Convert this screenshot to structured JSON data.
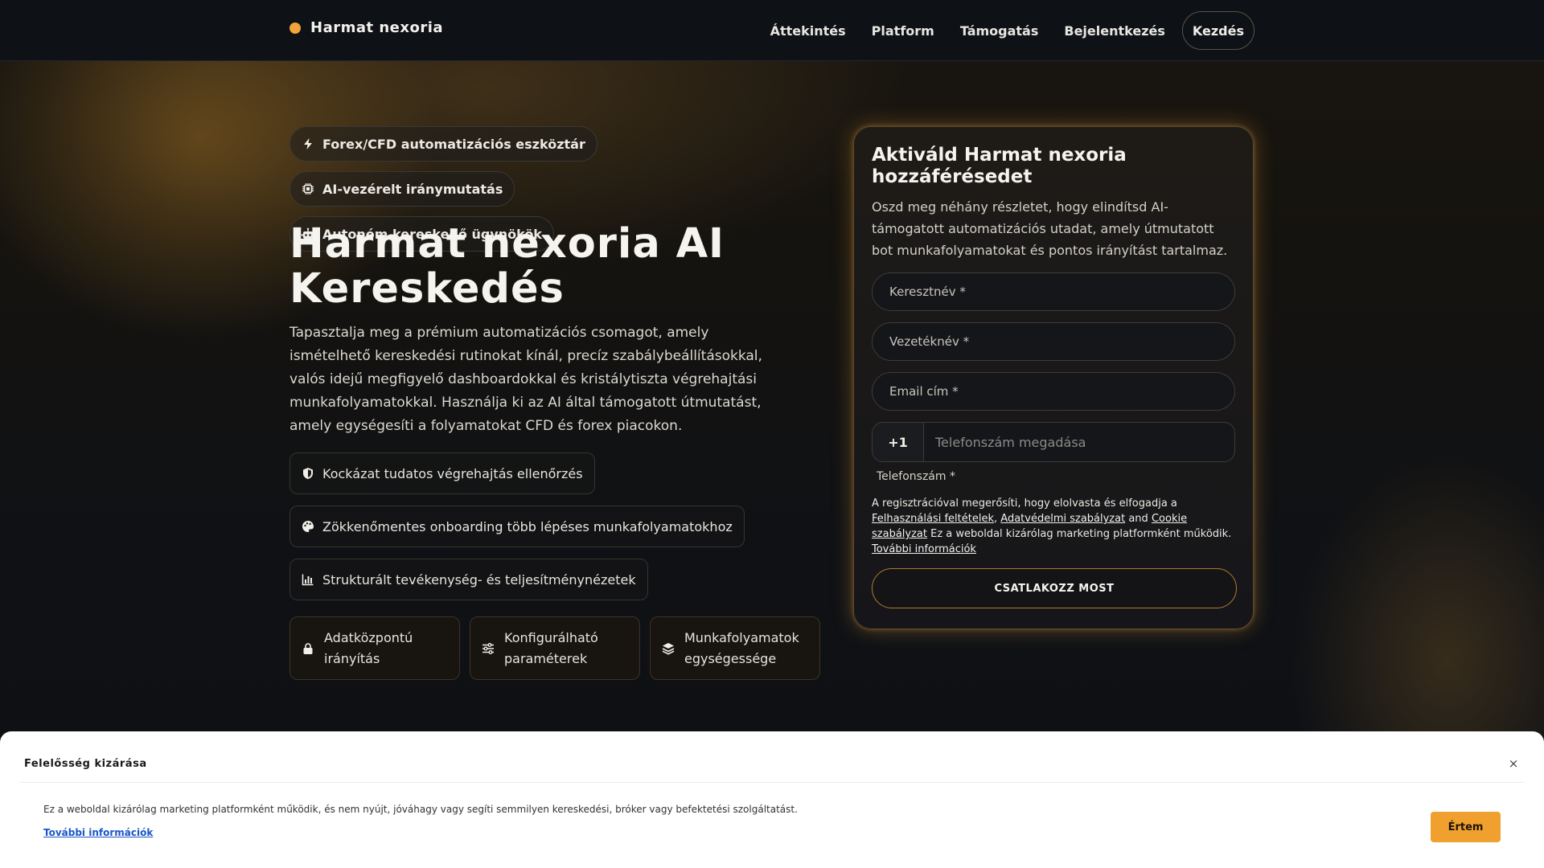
{
  "brand": {
    "name": "Harmat nexoria",
    "accent": "#f0a43a"
  },
  "nav": {
    "links": [
      "Áttekintés",
      "Platform",
      "Támogatás",
      "Bejelentkezés"
    ],
    "cta": "Kezdés"
  },
  "hero": {
    "pills": [
      {
        "icon": "lightning-icon",
        "label": "Forex/CFD automatizációs eszköztár"
      },
      {
        "icon": "chip-icon",
        "label": "AI-vezérelt iránymutatás"
      },
      {
        "icon": "robot-icon",
        "label": "Autonóm kereskedő ügynökök"
      }
    ],
    "title": "Harmat nexoria AI Kereskedés",
    "description": "Tapasztalja meg a prémium automatizációs csomagot, amely ismételhető kereskedési rutinokat kínál, precíz szabálybeállításokkal, valós idejű megfigyelő dashboardokkal és kristálytiszta végrehajtási munkafolyamatokkal. Használja ki az AI által támogatott útmutatást, amely egységesíti a folyamatokat CFD és forex piacokon.",
    "features": [
      {
        "icon": "shield-icon",
        "label": "Kockázat tudatos végrehajtás ellenőrzés"
      },
      {
        "icon": "palette-icon",
        "label": "Zökkenőmentes onboarding több lépéses munkafolyamatokhoz"
      },
      {
        "icon": "chart-icon",
        "label": "Strukturált tevékenység- és teljesítménynézetek"
      }
    ],
    "cards": [
      {
        "icon": "lock-icon",
        "label": "Adatközpontú irányítás"
      },
      {
        "icon": "sliders-icon",
        "label": "Konfigurálható paraméterek"
      },
      {
        "icon": "layers-icon",
        "label": "Munkafolyamatok egységessége"
      }
    ]
  },
  "form": {
    "title": "Aktiváld Harmat nexoria hozzáférésedet",
    "description": "Oszd meg néhány részletet, hogy elindítsd AI- támogatott automatizációs utadat, amely útmutatott bot munkafolyamatokat és pontos irányítást tartalmaz.",
    "first_name_placeholder": "Keresztnév *",
    "last_name_placeholder": "Vezetéknév *",
    "email_placeholder": "Email cím *",
    "phone_code": "+1",
    "phone_placeholder": "Telefonszám megadása",
    "phone_label": "Telefonszám *",
    "terms_prefix": "A regisztrációval megerősíti, hogy elolvasta és elfogadja a",
    "terms_link": "Felhasználási feltételek",
    "terms_comma": ",",
    "privacy_link": "Adatvédelmi szabályzat",
    "terms_and": "and",
    "cookie_link": "Cookie szabályzat",
    "terms_suffix": "Ez a weboldal kizárólag marketing platformként működik.",
    "more_link": "További információk",
    "submit": "CSATLAKOZZ MOST"
  },
  "disclaimer": {
    "title": "Felelősség kizárása",
    "close": "×",
    "text": "Ez a weboldal kizárólag marketing platformként működik, és nem nyújt, jóváhagy vagy segíti semmilyen kereskedési, bróker vagy befektetési szolgáltatást.",
    "link": "További információk",
    "button": "Értem",
    "button_color": "#f0a02f"
  }
}
